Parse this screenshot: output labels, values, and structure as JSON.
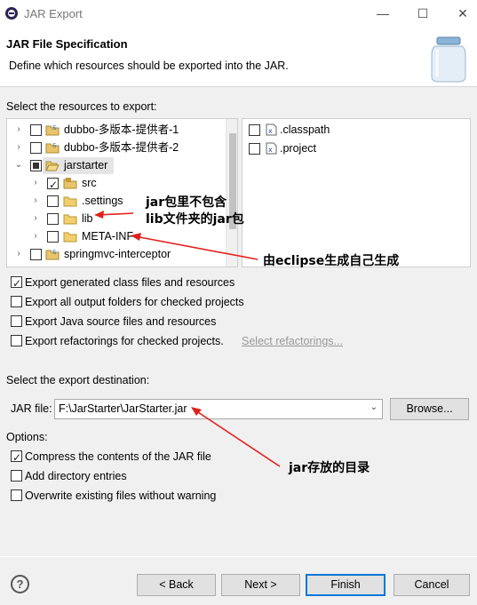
{
  "window": {
    "title": "JAR Export",
    "minimize": "—",
    "maximize": "☐",
    "close": "✕"
  },
  "header": {
    "title": "JAR File Specification",
    "description": "Define which resources should be exported into the JAR."
  },
  "resources": {
    "label": "Select the resources to export:",
    "tree": [
      {
        "label": "dubbo-多版本-提供者-1",
        "expand": "›",
        "state": "unchecked",
        "icon": "project-icon"
      },
      {
        "label": "dubbo-多版本-提供者-2",
        "expand": "›",
        "state": "unchecked",
        "icon": "project-icon"
      },
      {
        "label": "jarstarter",
        "expand": "⌄",
        "state": "partial",
        "icon": "project-icon"
      },
      {
        "label": "src",
        "expand": "›",
        "state": "checked",
        "icon": "source-folder-icon"
      },
      {
        "label": ".settings",
        "expand": "›",
        "state": "unchecked",
        "icon": "folder-icon"
      },
      {
        "label": "lib",
        "expand": "›",
        "state": "unchecked",
        "icon": "folder-icon"
      },
      {
        "label": "META-INF",
        "expand": "›",
        "state": "unchecked",
        "icon": "folder-icon"
      },
      {
        "label": "springmvc-interceptor",
        "expand": "›",
        "state": "unchecked",
        "icon": "project-icon"
      }
    ],
    "files": [
      {
        "label": ".classpath",
        "state": "unchecked",
        "icon": "x-file-icon"
      },
      {
        "label": ".project",
        "state": "unchecked",
        "icon": "x-file-icon"
      }
    ]
  },
  "options_top": [
    {
      "label": "Export generated class files and resources",
      "checked": true
    },
    {
      "label": "Export all output folders for checked projects",
      "checked": false
    },
    {
      "label": "Export Java source files and resources",
      "checked": false
    },
    {
      "label": "Export refactorings for checked projects.",
      "checked": false,
      "link": "Select refactorings..."
    }
  ],
  "destination": {
    "label": "Select the export destination:",
    "jar_label": "JAR file:",
    "jar_value": "F:\\JarStarter\\JarStarter.jar",
    "browse_label": "Browse..."
  },
  "options": {
    "label": "Options:",
    "items": [
      {
        "label": "Compress the contents of the JAR file",
        "checked": true
      },
      {
        "label": "Add directory entries",
        "checked": false
      },
      {
        "label": "Overwrite existing files without warning",
        "checked": false
      }
    ]
  },
  "buttons": {
    "help": "?",
    "back": "< Back",
    "next": "Next >",
    "finish": "Finish",
    "cancel": "Cancel"
  },
  "annotations": {
    "lib_note_1": "jar包里不包含",
    "lib_note_2": "lib文件夹的jar包",
    "metainf_note": "由eclipse生成自己生成",
    "jar_note": "jar存放的目录",
    "arrow_color": "#e2201b"
  }
}
